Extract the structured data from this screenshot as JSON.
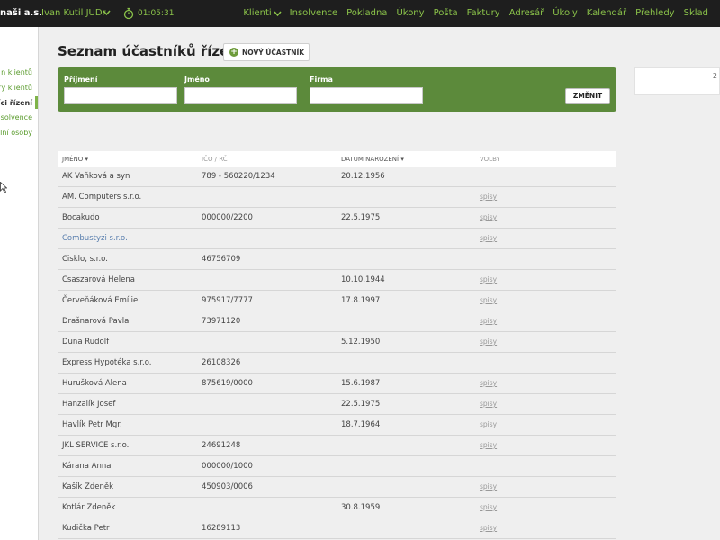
{
  "topbar": {
    "company": "naši a.s.",
    "user": "Ivan Kutil JUDr",
    "timer": "01:05:31",
    "nav": [
      "Klienti",
      "Insolvence",
      "Pokladna",
      "Úkony",
      "Pošta",
      "Faktury",
      "Adresář",
      "Úkoly",
      "Kalendář",
      "Přehledy",
      "Sklad"
    ]
  },
  "sidebar": {
    "items": [
      "n klientů",
      "ry klientů",
      "níci řízení",
      "nsolvence",
      "lní osoby"
    ]
  },
  "page": {
    "title": "Seznam účastníků řízení",
    "new_button": "NOVÝ ÚČASTNÍK"
  },
  "filter": {
    "surname_label": "Příjmení",
    "name_label": "Jméno",
    "company_label": "Firma",
    "surname_value": "",
    "name_value": "",
    "company_value": "",
    "change_button": "ZMĚNIT"
  },
  "right_box": {
    "text": "2"
  },
  "table": {
    "headers": {
      "name": "JMÉNO ▾",
      "ico": "IČO / RČ",
      "date": "DATUM NAROZENÍ ▾",
      "files": "VOLBY"
    },
    "rows": [
      {
        "name": "AK Vaňková a syn",
        "ico": "789 - 560220/1234",
        "date": "20.12.1956",
        "files": "",
        "link": false
      },
      {
        "name": "AM. Computers s.r.o.",
        "ico": "",
        "date": "",
        "files": "spisy",
        "link": false
      },
      {
        "name": "Bocakudo",
        "ico": "000000/2200",
        "date": "22.5.1975",
        "files": "spisy",
        "link": false
      },
      {
        "name": "Combustyzi s.r.o.",
        "ico": "",
        "date": "",
        "files": "spisy",
        "link": true
      },
      {
        "name": "Cisklo, s.r.o.",
        "ico": "46756709",
        "date": "",
        "files": "",
        "link": false
      },
      {
        "name": "Csaszarová Helena",
        "ico": "",
        "date": "10.10.1944",
        "files": "spisy",
        "link": false
      },
      {
        "name": "Červeňáková Emílie",
        "ico": "975917/7777",
        "date": "17.8.1997",
        "files": "spisy",
        "link": false
      },
      {
        "name": "Drašnarová Pavla",
        "ico": "73971120",
        "date": "",
        "files": "spisy",
        "link": false
      },
      {
        "name": "Duna Rudolf",
        "ico": "",
        "date": "5.12.1950",
        "files": "spisy",
        "link": false
      },
      {
        "name": "Express Hypotéka s.r.o.",
        "ico": "26108326",
        "date": "",
        "files": "",
        "link": false
      },
      {
        "name": "Hurušková Alena",
        "ico": "875619/0000",
        "date": "15.6.1987",
        "files": "spisy",
        "link": false
      },
      {
        "name": "Hanzalík Josef",
        "ico": "",
        "date": "22.5.1975",
        "files": "spisy",
        "link": false
      },
      {
        "name": "Havlík Petr Mgr.",
        "ico": "",
        "date": "18.7.1964",
        "files": "spisy",
        "link": false
      },
      {
        "name": "JKL SERVICE s.r.o.",
        "ico": "24691248",
        "date": "",
        "files": "spisy",
        "link": false
      },
      {
        "name": "Kárana Anna",
        "ico": "000000/1000",
        "date": "",
        "files": "",
        "link": false
      },
      {
        "name": "Kašík Zdeněk",
        "ico": "450903/0006",
        "date": "",
        "files": "spisy",
        "link": false
      },
      {
        "name": "Kotlár Zdeněk",
        "ico": "",
        "date": "30.8.1959",
        "files": "spisy",
        "link": false
      },
      {
        "name": "Kudička Petr",
        "ico": "16289113",
        "date": "",
        "files": "spisy",
        "link": false
      }
    ]
  }
}
